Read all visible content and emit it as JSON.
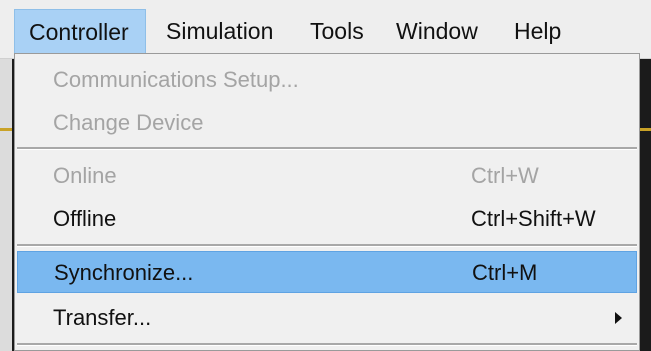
{
  "menubar": {
    "items": [
      {
        "label": "Controller"
      },
      {
        "label": "Simulation"
      },
      {
        "label": "Tools"
      },
      {
        "label": "Window"
      },
      {
        "label": "Help"
      }
    ],
    "active": "Controller"
  },
  "dropdown": {
    "items": [
      {
        "label": "Communications Setup...",
        "shortcut": "",
        "enabled": false
      },
      {
        "label": "Change Device",
        "shortcut": "",
        "enabled": false
      },
      {
        "label": "Online",
        "shortcut": "Ctrl+W",
        "enabled": false
      },
      {
        "label": "Offline",
        "shortcut": "Ctrl+Shift+W",
        "enabled": true
      },
      {
        "label": "Synchronize...",
        "shortcut": "Ctrl+M",
        "enabled": true,
        "highlighted": true
      },
      {
        "label": "Transfer...",
        "shortcut": "",
        "enabled": true,
        "submenu": true
      }
    ]
  },
  "colors": {
    "menubar_bg": "#eeeeee",
    "active_menu_bg": "#a9d1f5",
    "dropdown_bg": "#f0f0f0",
    "highlight_bg": "#7ab8f0",
    "disabled_text": "#a4a4a4"
  },
  "icons": {
    "submenu": "chevron-right-icon"
  }
}
